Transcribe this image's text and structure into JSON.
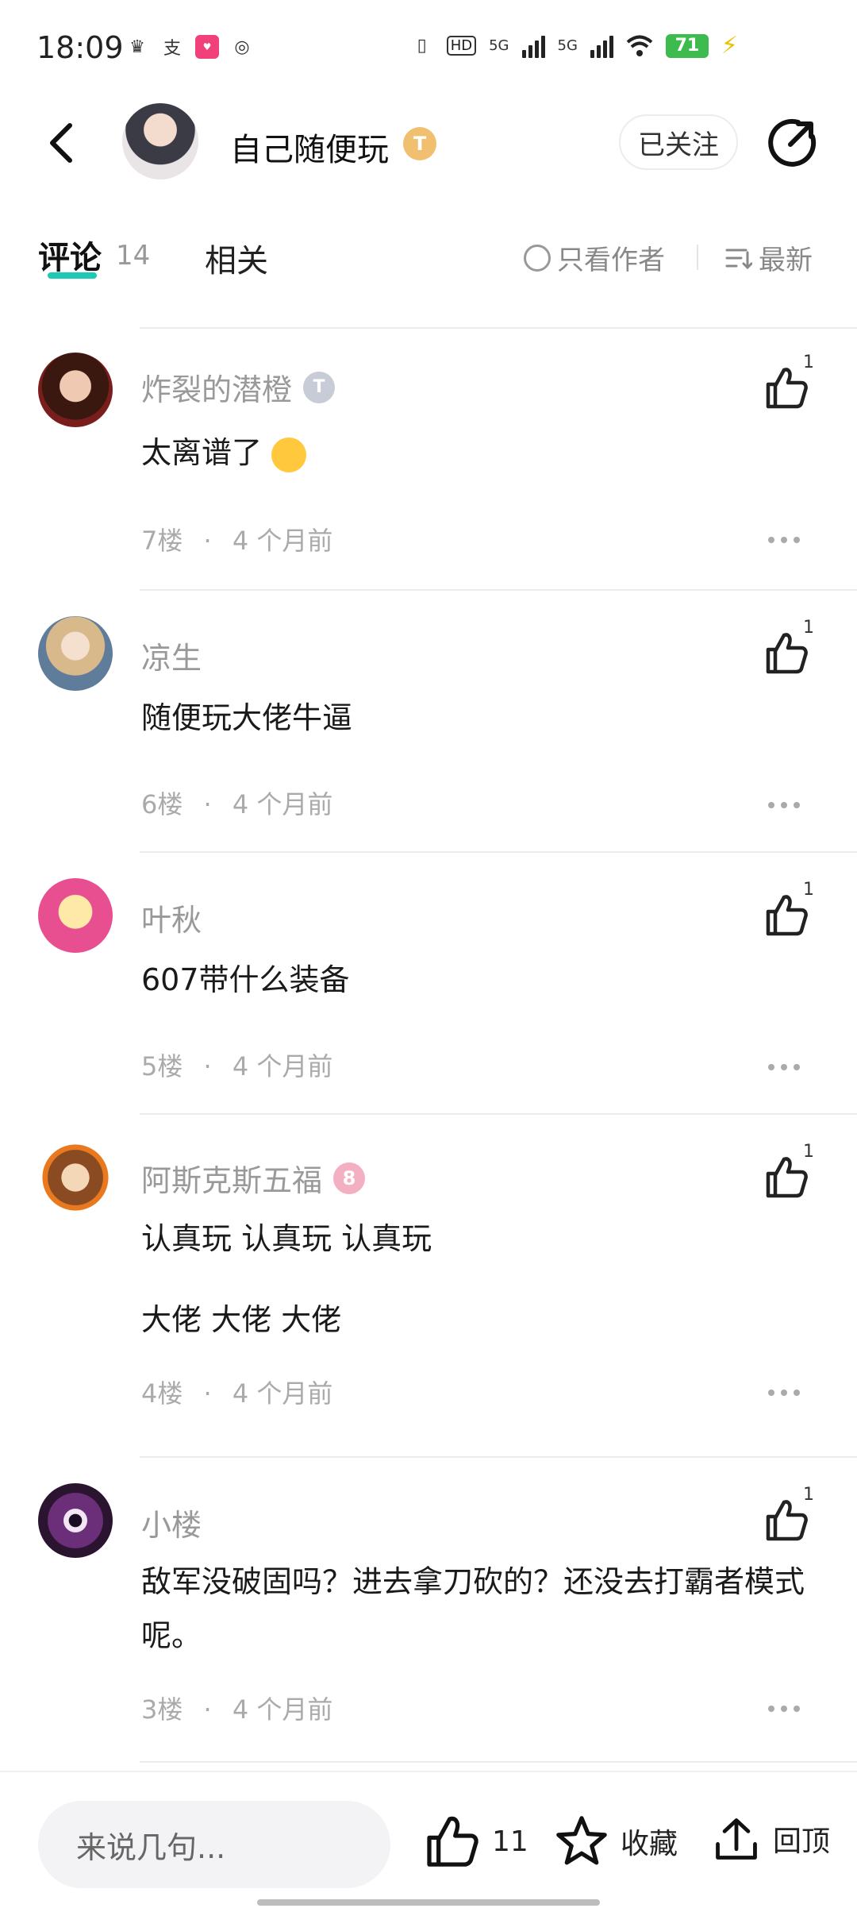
{
  "status_bar": {
    "time": "18:09",
    "battery": "71",
    "network_1": "5G",
    "network_2": "5G",
    "hd": "HD"
  },
  "header": {
    "title": "自己随便玩",
    "level_badge": "T",
    "follow_label": "已关注"
  },
  "tabs": {
    "comments_label": "评论",
    "comments_count": "14",
    "related_label": "相关",
    "author_only_label": "只看作者",
    "sort_label": "最新"
  },
  "comments": [
    {
      "name": "炸裂的潜橙",
      "badge": "T",
      "text": "太离谱了",
      "floor": "7楼",
      "time": "4 个月前",
      "likes": "1"
    },
    {
      "name": "凉生",
      "text": "随便玩大佬牛逼",
      "floor": "6楼",
      "time": "4 个月前",
      "likes": "1"
    },
    {
      "name": "叶秋",
      "text": "607带什么装备",
      "floor": "5楼",
      "time": "4 个月前",
      "likes": "1"
    },
    {
      "name": "阿斯克斯五福",
      "badge": "8",
      "text_line1": "认真玩  认真玩  认真玩",
      "text_line2": "大佬  大佬  大佬",
      "floor": "4楼",
      "time": "4 个月前",
      "likes": "1"
    },
    {
      "name": "小楼",
      "text": "敌军没破固吗？进去拿刀砍的？还没去打霸者模式呢。",
      "floor": "3楼",
      "time": "4 个月前",
      "likes": "1"
    }
  ],
  "meta_separator": "·",
  "bottom_bar": {
    "input_placeholder": "来说几句...",
    "like_count": "11",
    "favorite_label": "收藏",
    "top_label": "回顶"
  }
}
